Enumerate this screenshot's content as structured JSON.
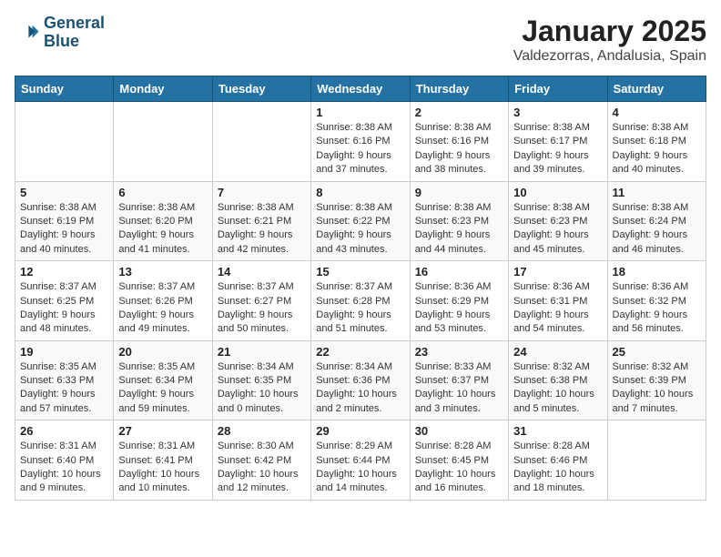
{
  "logo": {
    "line1": "General",
    "line2": "Blue"
  },
  "title": "January 2025",
  "subtitle": "Valdezorras, Andalusia, Spain",
  "headers": [
    "Sunday",
    "Monday",
    "Tuesday",
    "Wednesday",
    "Thursday",
    "Friday",
    "Saturday"
  ],
  "weeks": [
    [
      {
        "num": "",
        "info": ""
      },
      {
        "num": "",
        "info": ""
      },
      {
        "num": "",
        "info": ""
      },
      {
        "num": "1",
        "info": "Sunrise: 8:38 AM\nSunset: 6:16 PM\nDaylight: 9 hours\nand 37 minutes."
      },
      {
        "num": "2",
        "info": "Sunrise: 8:38 AM\nSunset: 6:16 PM\nDaylight: 9 hours\nand 38 minutes."
      },
      {
        "num": "3",
        "info": "Sunrise: 8:38 AM\nSunset: 6:17 PM\nDaylight: 9 hours\nand 39 minutes."
      },
      {
        "num": "4",
        "info": "Sunrise: 8:38 AM\nSunset: 6:18 PM\nDaylight: 9 hours\nand 40 minutes."
      }
    ],
    [
      {
        "num": "5",
        "info": "Sunrise: 8:38 AM\nSunset: 6:19 PM\nDaylight: 9 hours\nand 40 minutes."
      },
      {
        "num": "6",
        "info": "Sunrise: 8:38 AM\nSunset: 6:20 PM\nDaylight: 9 hours\nand 41 minutes."
      },
      {
        "num": "7",
        "info": "Sunrise: 8:38 AM\nSunset: 6:21 PM\nDaylight: 9 hours\nand 42 minutes."
      },
      {
        "num": "8",
        "info": "Sunrise: 8:38 AM\nSunset: 6:22 PM\nDaylight: 9 hours\nand 43 minutes."
      },
      {
        "num": "9",
        "info": "Sunrise: 8:38 AM\nSunset: 6:23 PM\nDaylight: 9 hours\nand 44 minutes."
      },
      {
        "num": "10",
        "info": "Sunrise: 8:38 AM\nSunset: 6:23 PM\nDaylight: 9 hours\nand 45 minutes."
      },
      {
        "num": "11",
        "info": "Sunrise: 8:38 AM\nSunset: 6:24 PM\nDaylight: 9 hours\nand 46 minutes."
      }
    ],
    [
      {
        "num": "12",
        "info": "Sunrise: 8:37 AM\nSunset: 6:25 PM\nDaylight: 9 hours\nand 48 minutes."
      },
      {
        "num": "13",
        "info": "Sunrise: 8:37 AM\nSunset: 6:26 PM\nDaylight: 9 hours\nand 49 minutes."
      },
      {
        "num": "14",
        "info": "Sunrise: 8:37 AM\nSunset: 6:27 PM\nDaylight: 9 hours\nand 50 minutes."
      },
      {
        "num": "15",
        "info": "Sunrise: 8:37 AM\nSunset: 6:28 PM\nDaylight: 9 hours\nand 51 minutes."
      },
      {
        "num": "16",
        "info": "Sunrise: 8:36 AM\nSunset: 6:29 PM\nDaylight: 9 hours\nand 53 minutes."
      },
      {
        "num": "17",
        "info": "Sunrise: 8:36 AM\nSunset: 6:31 PM\nDaylight: 9 hours\nand 54 minutes."
      },
      {
        "num": "18",
        "info": "Sunrise: 8:36 AM\nSunset: 6:32 PM\nDaylight: 9 hours\nand 56 minutes."
      }
    ],
    [
      {
        "num": "19",
        "info": "Sunrise: 8:35 AM\nSunset: 6:33 PM\nDaylight: 9 hours\nand 57 minutes."
      },
      {
        "num": "20",
        "info": "Sunrise: 8:35 AM\nSunset: 6:34 PM\nDaylight: 9 hours\nand 59 minutes."
      },
      {
        "num": "21",
        "info": "Sunrise: 8:34 AM\nSunset: 6:35 PM\nDaylight: 10 hours\nand 0 minutes."
      },
      {
        "num": "22",
        "info": "Sunrise: 8:34 AM\nSunset: 6:36 PM\nDaylight: 10 hours\nand 2 minutes."
      },
      {
        "num": "23",
        "info": "Sunrise: 8:33 AM\nSunset: 6:37 PM\nDaylight: 10 hours\nand 3 minutes."
      },
      {
        "num": "24",
        "info": "Sunrise: 8:32 AM\nSunset: 6:38 PM\nDaylight: 10 hours\nand 5 minutes."
      },
      {
        "num": "25",
        "info": "Sunrise: 8:32 AM\nSunset: 6:39 PM\nDaylight: 10 hours\nand 7 minutes."
      }
    ],
    [
      {
        "num": "26",
        "info": "Sunrise: 8:31 AM\nSunset: 6:40 PM\nDaylight: 10 hours\nand 9 minutes."
      },
      {
        "num": "27",
        "info": "Sunrise: 8:31 AM\nSunset: 6:41 PM\nDaylight: 10 hours\nand 10 minutes."
      },
      {
        "num": "28",
        "info": "Sunrise: 8:30 AM\nSunset: 6:42 PM\nDaylight: 10 hours\nand 12 minutes."
      },
      {
        "num": "29",
        "info": "Sunrise: 8:29 AM\nSunset: 6:44 PM\nDaylight: 10 hours\nand 14 minutes."
      },
      {
        "num": "30",
        "info": "Sunrise: 8:28 AM\nSunset: 6:45 PM\nDaylight: 10 hours\nand 16 minutes."
      },
      {
        "num": "31",
        "info": "Sunrise: 8:28 AM\nSunset: 6:46 PM\nDaylight: 10 hours\nand 18 minutes."
      },
      {
        "num": "",
        "info": ""
      }
    ]
  ]
}
